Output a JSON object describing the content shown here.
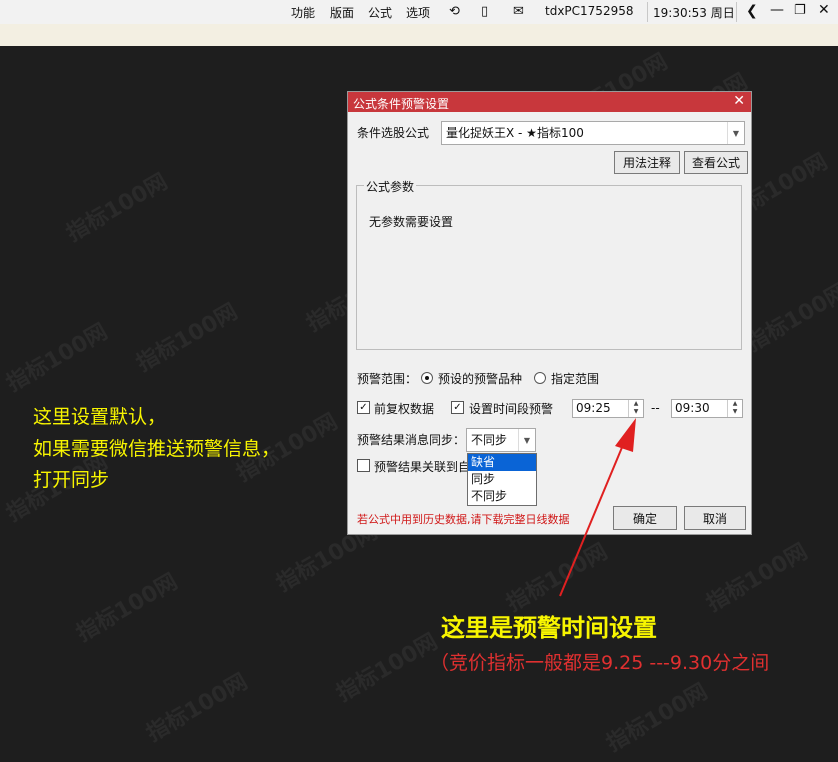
{
  "topbar": {
    "menus": [
      "功能",
      "版面",
      "公式",
      "选项"
    ],
    "station": "tdxPC1752958",
    "time": "19:30:53 周日"
  },
  "dialog": {
    "title": "公式条件预警设置",
    "formula_label": "条件选股公式",
    "formula_value": "量化捉妖王X  -  ★指标100",
    "usage_button": "用法注释",
    "view_button": "查看公式",
    "params_legend": "公式参数",
    "params_text": "无参数需要设置",
    "range_label": "预警范围：",
    "range_option1": "预设的预警品种",
    "range_option2": "指定范围",
    "prev_adjust": "前复权数据",
    "time_period": "设置时间段预警",
    "time_start": "09:25",
    "time_sep": "--",
    "time_end": "09:30",
    "sync_label": "预警结果消息同步：",
    "sync_value": "不同步",
    "sync_options": [
      "缺省",
      "同步",
      "不同步"
    ],
    "link_label": "预警结果关联到自",
    "warning_text": "若公式中用到历史数据,请下载完整日线数据",
    "ok_button": "确定",
    "cancel_button": "取消"
  },
  "annotations": {
    "left_line1": "这里设置默认，",
    "left_line2": "如果需要微信推送预警信息，",
    "left_line3": "打开同步",
    "bottom_title": "这里是预警时间设置",
    "bottom_sub": "（竞价指标一般都是9.25 ---9.30分之间"
  },
  "colors": {
    "annotation_yellow": "#f8f500",
    "annotation_red": "#e03030",
    "title_red": "#c8373c",
    "highlight": "#ff788c"
  }
}
